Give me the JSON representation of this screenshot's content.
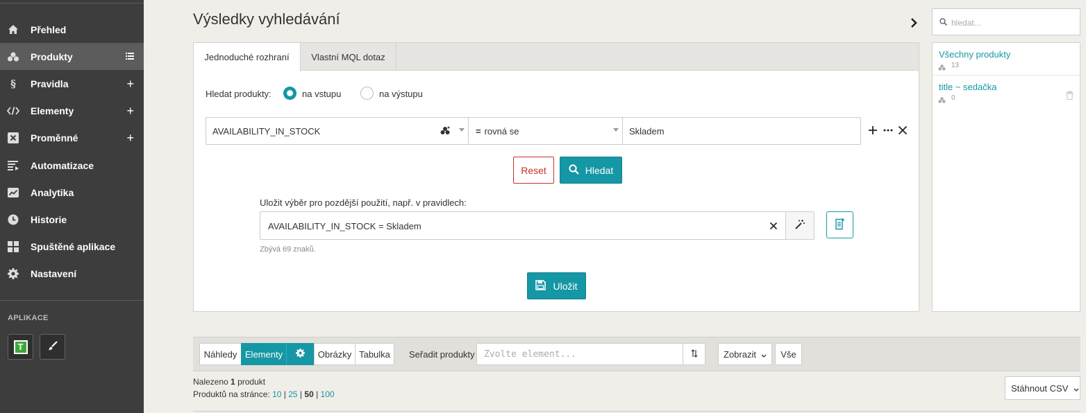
{
  "sidebar": {
    "items": [
      {
        "label": "Přehled",
        "icon": "home-icon",
        "suffix": ""
      },
      {
        "label": "Produkty",
        "icon": "products-icon",
        "suffix": "☰"
      },
      {
        "label": "Pravidla",
        "icon": "section-icon",
        "suffix": "+"
      },
      {
        "label": "Elementy",
        "icon": "code-icon",
        "suffix": "+"
      },
      {
        "label": "Proměnné",
        "icon": "variable-icon",
        "suffix": "+"
      },
      {
        "label": "Automatizace",
        "icon": "automation-icon",
        "suffix": ""
      },
      {
        "label": "Analytika",
        "icon": "chart-icon",
        "suffix": ""
      },
      {
        "label": "Historie",
        "icon": "clock-icon",
        "suffix": ""
      },
      {
        "label": "Spuštěné aplikace",
        "icon": "apps-grid-icon",
        "suffix": ""
      },
      {
        "label": "Nastavení",
        "icon": "gear-icon",
        "suffix": ""
      }
    ],
    "active_index": 1,
    "apps_title": "APLIKACE",
    "app_letter": "T"
  },
  "header": {
    "title": "Výsledky vyhledávání"
  },
  "tabs": [
    {
      "label": "Jednoduché rozhraní",
      "active": true
    },
    {
      "label": "Vlastní MQL dotaz",
      "active": false
    }
  ],
  "search": {
    "label": "Hledat produkty:",
    "options": [
      "na vstupu",
      "na výstupu"
    ],
    "selected": "na vstupu"
  },
  "condition": {
    "field": "AVAILABILITY_IN_STOCK",
    "operator_symbol": "=",
    "operator": "rovná se",
    "value": "Skladem"
  },
  "buttons": {
    "reset": "Reset",
    "search": "Hledat",
    "save": "Uložit"
  },
  "save_selection": {
    "label": "Uložit výběr pro pozdější použití, např. v pravidlech:",
    "value": "AVAILABILITY_IN_STOCK = Skladem",
    "remaining": "Zbývá 69 znaků."
  },
  "right_panel": {
    "search_placeholder": "hledat...",
    "saved": [
      {
        "name": "Všechny produkty",
        "count": "13"
      },
      {
        "name": "title ~ sedačka",
        "count": "0"
      }
    ]
  },
  "toolbar": {
    "views": [
      "Náhledy",
      "Elementy",
      "Obrázky",
      "Tabulka"
    ],
    "active_view": "Elementy",
    "sort_label": "Seřadit produkty",
    "sort_placeholder": "Zvolte element...",
    "show_label": "Zobrazit",
    "all_label": "Vše"
  },
  "results": {
    "found_prefix": "Nalezeno",
    "found_count": "1",
    "found_suffix": "produkt",
    "per_page_label": "Produktů na stránce:",
    "per_page_options": [
      "10",
      "25",
      "50",
      "100"
    ],
    "per_page_current": "50",
    "download_csv": "Stáhnout CSV"
  },
  "colors": {
    "accent": "#1597a5",
    "sidebar": "#3d3d3d",
    "danger": "#c9302c",
    "background": "#f0eee9"
  }
}
